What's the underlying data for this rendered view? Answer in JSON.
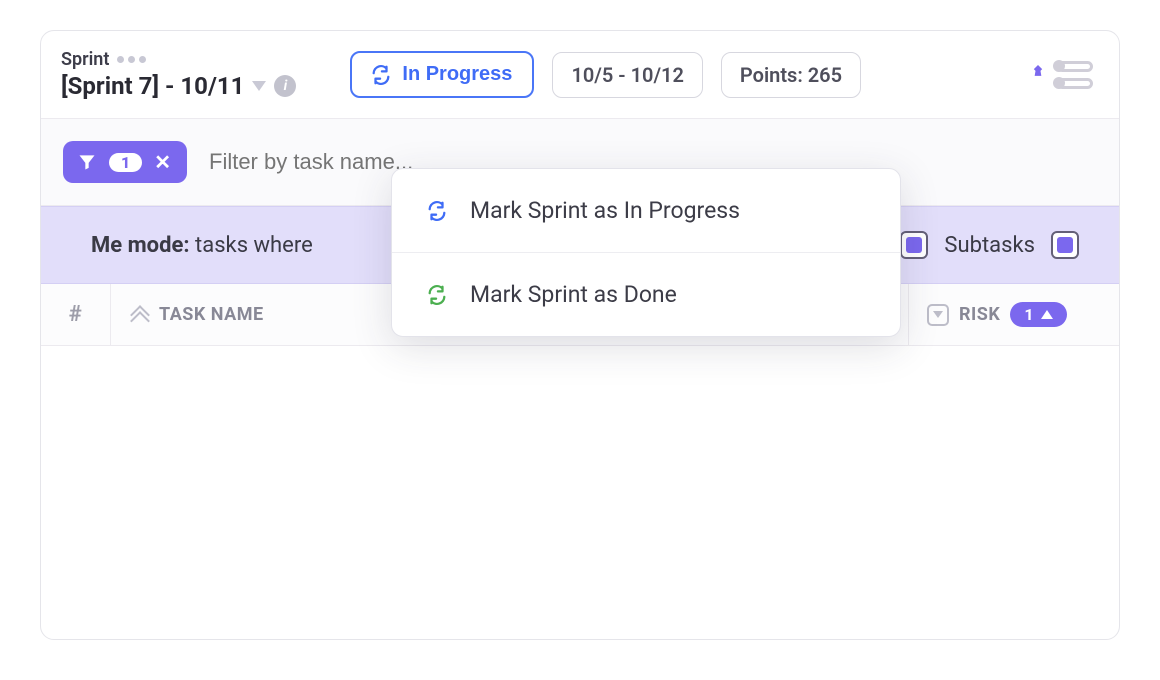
{
  "header": {
    "sprint_type_label": "Sprint",
    "sprint_name": "[Sprint 7] - 10/11",
    "status_label": "In Progress",
    "date_range": "10/5 - 10/12",
    "points_label": "Points: 265"
  },
  "filter": {
    "active_count": "1",
    "placeholder": "Filter by task name..."
  },
  "me_mode": {
    "label": "Me mode:",
    "text": "tasks where",
    "subtasks_label": "Subtasks",
    "subtasks_check_left": true,
    "subtasks_check_right": true
  },
  "dropdown": {
    "items": [
      {
        "label": "Mark Sprint as In Progress",
        "icon_color": "blue"
      },
      {
        "label": "Mark Sprint as Done",
        "icon_color": "green"
      }
    ]
  },
  "table": {
    "hash_label": "#",
    "task_name_label": "TASK NAME",
    "risk_label": "RISK",
    "risk_count": "1"
  }
}
